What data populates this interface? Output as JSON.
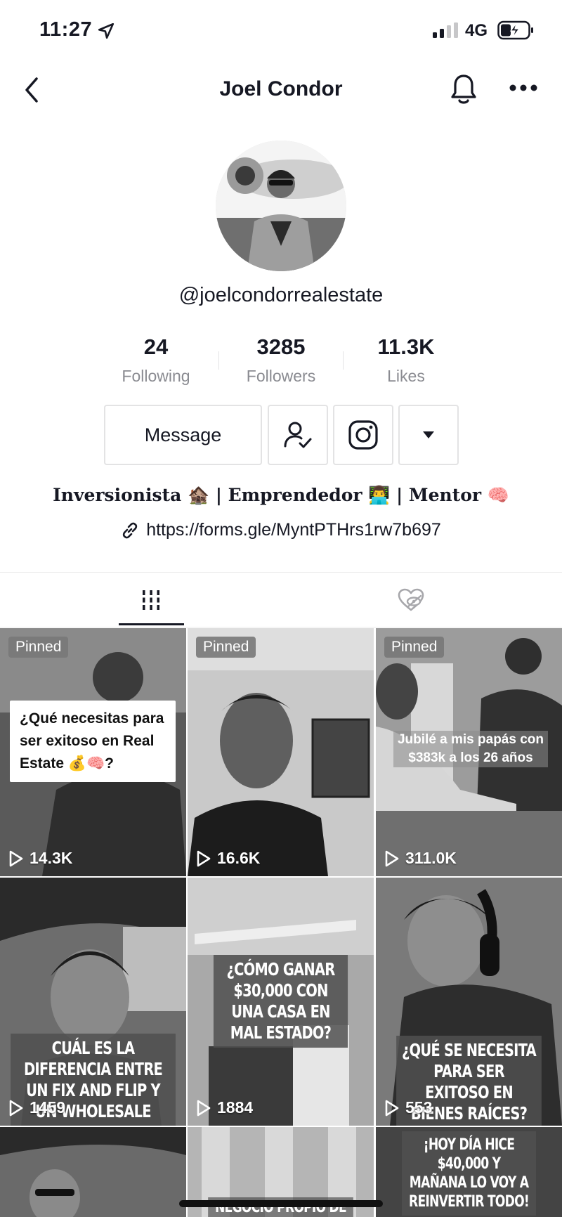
{
  "status": {
    "time": "11:27",
    "network": "4G"
  },
  "nav": {
    "title": "Joel Condor"
  },
  "profile": {
    "username": "@joelcondorrealestate",
    "stats": [
      {
        "value": "24",
        "label": "Following"
      },
      {
        "value": "3285",
        "label": "Followers"
      },
      {
        "value": "11.3K",
        "label": "Likes"
      }
    ],
    "message_label": "Message",
    "bio": "Inversionista 🏚️ | Emprendedor 👨‍💻 | Mentor 🧠",
    "link": "https://forms.gle/MyntPTHrs1rw7b697"
  },
  "videos": [
    {
      "pinned": "Pinned",
      "views": "14.3K",
      "caption": "¿Qué necesitas para ser exitoso en Real Estate 💰🧠?"
    },
    {
      "pinned": "Pinned",
      "views": "16.6K",
      "caption": ""
    },
    {
      "pinned": "Pinned",
      "views": "311.0K",
      "caption": "Jubilé a mis papás con $383k a los 26 años"
    },
    {
      "pinned": "",
      "views": "1459",
      "caption": "CUÁL ES LA DIFERENCIA ENTRE UN FIX AND FLIP Y UN WHOLESALE DEAL"
    },
    {
      "pinned": "",
      "views": "1884",
      "caption": "¿CÓMO GANAR $30,000 CON UNA CASA EN MAL ESTADO?"
    },
    {
      "pinned": "",
      "views": "553",
      "caption": "¿QUÉ SE NECESITA PARA SER EXITOSO EN BIENES RAÍCES?"
    },
    {
      "pinned": "",
      "views": "",
      "caption": ""
    },
    {
      "pinned": "",
      "views": "",
      "caption": "NEGOCIO PROPIO DE"
    },
    {
      "pinned": "",
      "views": "",
      "caption": "¡HOY DÍA HICE $40,000 Y MAÑANA LO VOY A REINVERTIR TODO!"
    }
  ],
  "icons": {
    "location": "location-arrow-icon",
    "back": "chevron-left-icon",
    "bell": "bell-icon",
    "more": "more-icon",
    "follow_status": "user-check-icon",
    "instagram": "instagram-icon",
    "dropdown": "caret-down-icon",
    "link": "link-icon",
    "videos_tab": "grid-icon",
    "liked_tab": "hidden-heart-icon",
    "play": "play-icon"
  }
}
